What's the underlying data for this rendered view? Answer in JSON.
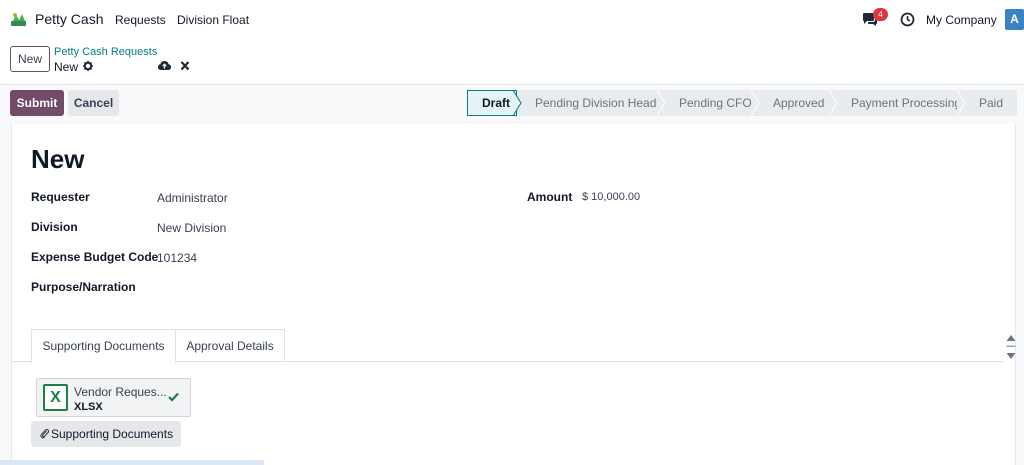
{
  "navbar": {
    "app_name": "Petty Cash",
    "menus": [
      "Requests",
      "Division Float"
    ],
    "notification_count": "4",
    "company": "My Company",
    "avatar_letter": "A"
  },
  "control_panel": {
    "new_label": "New",
    "breadcrumb_parent": "Petty Cash Requests",
    "breadcrumb_current": "New"
  },
  "actions": {
    "submit_label": "Submit",
    "cancel_label": "Cancel"
  },
  "statusbar": {
    "stages": [
      "Draft",
      "Pending Division Head",
      "Pending CFO",
      "Approved",
      "Payment Processing",
      "Paid"
    ],
    "active": "Draft"
  },
  "form": {
    "title": "New",
    "fields": [
      {
        "label": "Requester",
        "value": "Administrator"
      },
      {
        "label": "Division",
        "value": "New Division"
      },
      {
        "label": "Expense Budget Code",
        "value": "101234"
      },
      {
        "label": "Purpose/Narration",
        "value": ""
      }
    ],
    "amount_label": "Amount",
    "amount_value": "$ 10,000.00"
  },
  "tabs": [
    {
      "label": "Supporting Documents",
      "active": true
    },
    {
      "label": "Approval Details",
      "active": false
    }
  ],
  "attachment": {
    "icon_letter": "X",
    "name": "Vendor Reques...",
    "ext": "XLSX"
  },
  "attach_button_label": "Supporting Documents",
  "colors": {
    "brand": "#714b67",
    "link": "#017e84",
    "badge": "#dc3545",
    "excel": "#1d7f46",
    "avatar": "#3b82c4"
  }
}
